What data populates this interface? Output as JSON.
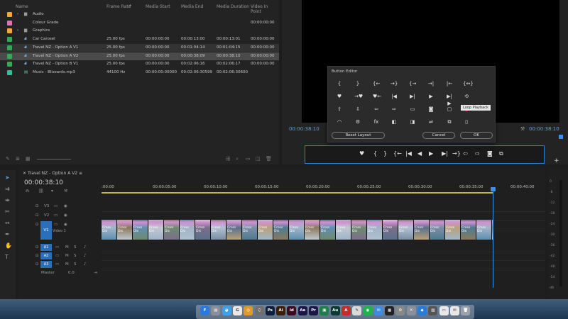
{
  "project": {
    "columns": [
      "Name",
      "Frame Rate",
      "Media Start",
      "Media End",
      "Media Duration",
      "Video In Point"
    ],
    "rows": [
      {
        "name": "Audio",
        "color": "#f2a540",
        "kind": "folder"
      },
      {
        "name": "Colour Grade",
        "color": "#e36fb7",
        "kind": "item",
        "video_in": "00:00:00:00"
      },
      {
        "name": "Graphics",
        "color": "#f2a540",
        "kind": "folder"
      },
      {
        "name": "Car Carosel",
        "color": "#35a854",
        "kind": "sequence",
        "frame_rate": "25.00 fps",
        "start": "00:00:00:00",
        "end": "00:00:13:00",
        "duration": "00:00:13:01",
        "video_in": "00:00:00:00"
      },
      {
        "name": "Travel NZ - Option A V1",
        "color": "#35a854",
        "kind": "sequence",
        "frame_rate": "25.00 fps",
        "start": "00:00:00:00",
        "end": "00:01:04:14",
        "duration": "00:01:04:15",
        "video_in": "00:00:00:00"
      },
      {
        "name": "Travel NZ - Option A V2",
        "color": "#35a854",
        "kind": "sequence",
        "frame_rate": "25.00 fps",
        "start": "00:00:00:00",
        "end": "00:00:38:09",
        "duration": "00:00:38:10",
        "video_in": "00:00:00:00",
        "selected": true
      },
      {
        "name": "Travel NZ - Option B V1",
        "color": "#35a854",
        "kind": "sequence",
        "frame_rate": "25.00 fps",
        "start": "00:00:00:00",
        "end": "00:02:06:16",
        "duration": "00:02:06:17",
        "video_in": "00:00:00:00"
      },
      {
        "name": "Music - Blizzards.mp3",
        "color": "#2fbf9c",
        "kind": "audio",
        "frame_rate": "44100 Hz",
        "start": "00:00:00:00000",
        "end": "00:02:06:30599",
        "duration": "00:02:06:30600"
      }
    ]
  },
  "program": {
    "timecode_left": "00:00:38:10",
    "timecode_right": "00:00:38:10"
  },
  "button_editor": {
    "title": "Button Editor",
    "reset_label": "Reset Layout",
    "cancel_label": "Cancel",
    "ok_label": "OK",
    "tooltip": "Loop Playback",
    "rows": [
      [
        "{",
        "}",
        "{←",
        "→}",
        "{→",
        "→|",
        "|←",
        "{↔}"
      ],
      [
        "♥",
        "→♥",
        "♥←",
        "|◀",
        "▶|",
        "▶",
        "▶|▶",
        "⟲"
      ],
      [
        "⇧",
        "⇩",
        "⇦",
        "⇨",
        "▭",
        "◙",
        "▢",
        "●"
      ],
      [
        "◠",
        "⚙",
        "fx",
        "◧",
        "◨",
        "⇌",
        "⧉",
        "▯"
      ]
    ]
  },
  "transport": [
    "♥",
    "{",
    "}",
    "{←",
    "|◀",
    "◀",
    "▶",
    "▶|",
    "→}",
    "⇦",
    "⇨",
    "◙",
    "⧉"
  ],
  "timeline": {
    "tab": "Travel NZ - Option A V2",
    "timecode": "00:00:38:10",
    "ruler": [
      ":00:00",
      "00:00:05:00",
      "00:00:10:00",
      "00:00:15:00",
      "00:00:20:00",
      "00:00:25:00",
      "00:00:30:00",
      "00:00:35:00",
      "00:00:40:00"
    ],
    "video_tracks": [
      "V3",
      "V2",
      "V1"
    ],
    "v1_label": "Video 1",
    "audio_tracks": [
      "A1",
      "A2",
      "A3"
    ],
    "master_label": "Master",
    "master_value": "0.0",
    "clip_label": "Cross Dis"
  },
  "meter": {
    "ticks": [
      "0",
      "-6",
      "-12",
      "-18",
      "-24",
      "-30",
      "-36",
      "-42",
      "-48",
      "-54",
      "dB"
    ]
  },
  "dock": {
    "apps": [
      {
        "label": "F",
        "color": "#2a7ad9"
      },
      {
        "label": "▤",
        "color": "#8a8f99"
      },
      {
        "label": "◕",
        "color": "#3ea0e8"
      },
      {
        "label": "G",
        "color": "#e8e8e8"
      },
      {
        "label": "◎",
        "color": "#e09a2a"
      },
      {
        "label": "♫",
        "color": "#6f6f6f"
      },
      {
        "label": "Ps",
        "color": "#0f1e3a"
      },
      {
        "label": "Ai",
        "color": "#3b1f08"
      },
      {
        "label": "Id",
        "color": "#3a0a20"
      },
      {
        "label": "Ae",
        "color": "#1c1547"
      },
      {
        "label": "Pr",
        "color": "#1c1547"
      },
      {
        "label": "▣",
        "color": "#1f7e4a"
      },
      {
        "label": "Au",
        "color": "#0b3a33"
      },
      {
        "label": "A",
        "color": "#c62a2a"
      },
      {
        "label": "✎",
        "color": "#d9d9d9"
      },
      {
        "label": "◉",
        "color": "#1fb24f"
      },
      {
        "label": "✉",
        "color": "#3d8ce0"
      },
      {
        "label": "▦",
        "color": "#222"
      },
      {
        "label": "⚙",
        "color": "#888"
      },
      {
        "label": "✕",
        "color": "#8a8f99"
      },
      {
        "label": "◆",
        "color": "#2a7ad9"
      },
      {
        "label": "▨",
        "color": "#555"
      },
      {
        "label": "▭",
        "color": "#e8e8e8"
      },
      {
        "label": "✉",
        "color": "#e8e8e8"
      },
      {
        "label": "🗑",
        "color": "#9aa3ad"
      }
    ]
  }
}
